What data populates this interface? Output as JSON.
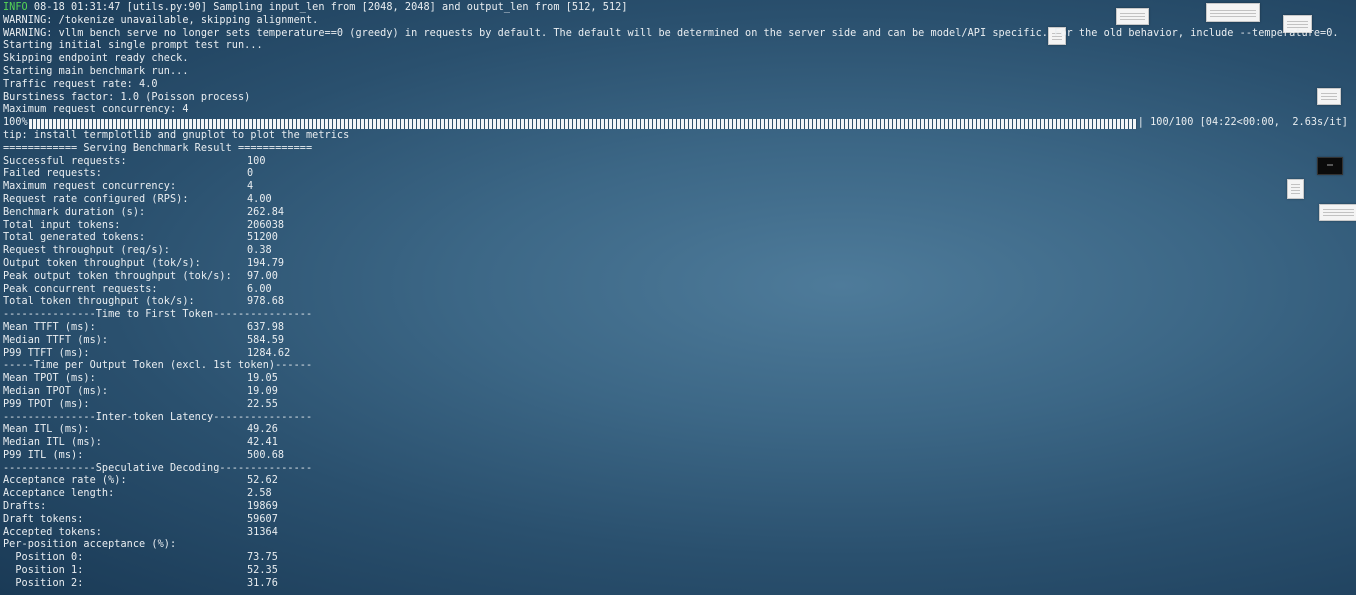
{
  "log": {
    "info_tag": "INFO",
    "info_rest": " 08-18 01:31:47 [utils.py:90] Sampling input_len from [2048, 2048] and output_len from [512, 512]",
    "lines_before": [
      "WARNING: /tokenize unavailable, skipping alignment.",
      "WARNING: vllm bench serve no longer sets temperature==0 (greedy) in requests by default. The default will be determined on the server side and can be model/API specific. For the old behavior, include --temperature=0.",
      "Starting initial single prompt test run...",
      "Skipping endpoint ready check.",
      "Starting main benchmark run...",
      "Traffic request rate: 4.0",
      "Burstiness factor: 1.0 (Poisson process)",
      "Maximum request concurrency: 4"
    ],
    "progress": {
      "percent_label": "100%",
      "fraction": 1.0,
      "status": " 100/100 [04:22<00:00,  2.63s/it]"
    },
    "tip": "tip: install termplotlib and gnuplot to plot the metrics",
    "result_header": "============ Serving Benchmark Result ============"
  },
  "results": [
    {
      "k": "Successful requests:",
      "v": "100"
    },
    {
      "k": "Failed requests:",
      "v": "0"
    },
    {
      "k": "Maximum request concurrency:",
      "v": "4"
    },
    {
      "k": "Request rate configured (RPS):",
      "v": "4.00"
    },
    {
      "k": "Benchmark duration (s):",
      "v": "262.84"
    },
    {
      "k": "Total input tokens:",
      "v": "206038"
    },
    {
      "k": "Total generated tokens:",
      "v": "51200"
    },
    {
      "k": "Request throughput (req/s):",
      "v": "0.38"
    },
    {
      "k": "Output token throughput (tok/s):",
      "v": "194.79"
    },
    {
      "k": "Peak output token throughput (tok/s):",
      "v": "97.00"
    },
    {
      "k": "Peak concurrent requests:",
      "v": "6.00"
    },
    {
      "k": "Total token throughput (tok/s):",
      "v": "978.68"
    },
    {
      "sep": "---------------Time to First Token----------------"
    },
    {
      "k": "Mean TTFT (ms):",
      "v": "637.98"
    },
    {
      "k": "Median TTFT (ms):",
      "v": "584.59"
    },
    {
      "k": "P99 TTFT (ms):",
      "v": "1284.62"
    },
    {
      "sep": "-----Time per Output Token (excl. 1st token)------"
    },
    {
      "k": "Mean TPOT (ms):",
      "v": "19.05"
    },
    {
      "k": "Median TPOT (ms):",
      "v": "19.09"
    },
    {
      "k": "P99 TPOT (ms):",
      "v": "22.55"
    },
    {
      "sep": "---------------Inter-token Latency----------------"
    },
    {
      "k": "Mean ITL (ms):",
      "v": "49.26"
    },
    {
      "k": "Median ITL (ms):",
      "v": "42.41"
    },
    {
      "k": "P99 ITL (ms):",
      "v": "500.68"
    },
    {
      "sep": "---------------Speculative Decoding---------------"
    },
    {
      "k": "Acceptance rate (%):",
      "v": "52.62"
    },
    {
      "k": "Acceptance length:",
      "v": "2.58"
    },
    {
      "k": "Drafts:",
      "v": "19869"
    },
    {
      "k": "Draft tokens:",
      "v": "59607"
    },
    {
      "k": "Accepted tokens:",
      "v": "31364"
    },
    {
      "k": "Per-position acceptance (%):",
      "v": ""
    },
    {
      "k": "  Position 0:",
      "v": "73.75"
    },
    {
      "k": "  Position 1:",
      "v": "52.35"
    },
    {
      "k": "  Position 2:",
      "v": "31.76"
    }
  ],
  "colors": {
    "info": "#55d655",
    "text": "#eaeef1",
    "bar": "#f2f5f7"
  },
  "desktop_icons": [
    "document-thumbnail-icon",
    "window-thumbnail-icon",
    "document-thumbnail-icon",
    "terminal-thumbnail-icon"
  ]
}
